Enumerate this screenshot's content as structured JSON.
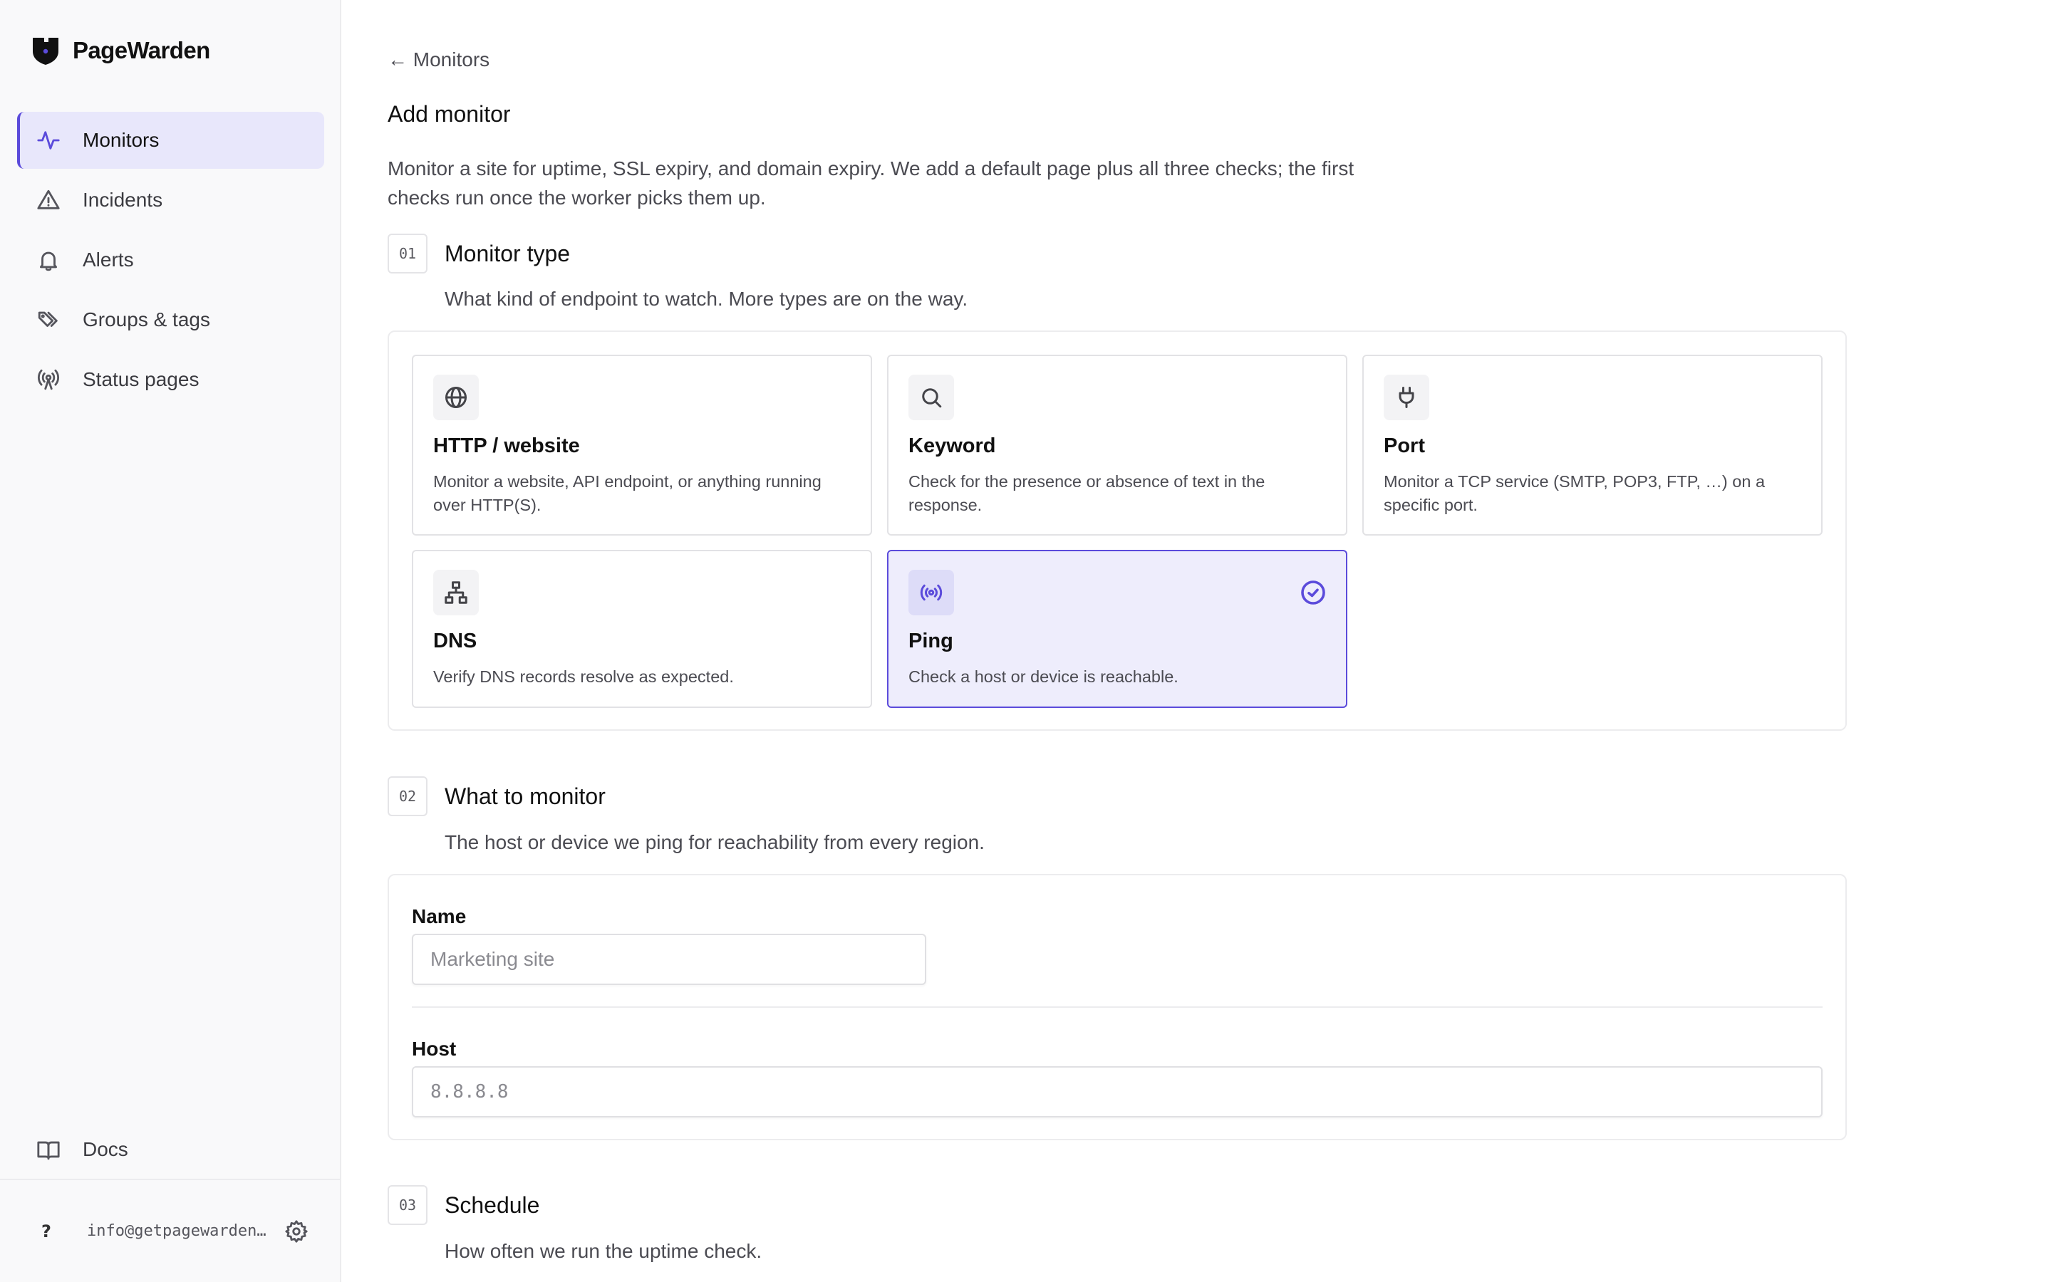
{
  "sidebar": {
    "brand": "PageWarden",
    "nav": [
      {
        "label": "Monitors",
        "icon": "activity-icon",
        "active": true
      },
      {
        "label": "Incidents",
        "icon": "warning-triangle-icon",
        "active": false
      },
      {
        "label": "Alerts",
        "icon": "bell-icon",
        "active": false
      },
      {
        "label": "Groups & tags",
        "icon": "tags-icon",
        "active": false
      },
      {
        "label": "Status pages",
        "icon": "broadcast-icon",
        "active": false
      }
    ],
    "docs": {
      "label": "Docs",
      "icon": "book-icon"
    },
    "footer": {
      "help": "?",
      "email": "info@getpagewarden…",
      "settings_icon": "gear-icon"
    }
  },
  "main": {
    "back_link": "← Monitors",
    "title": "Add monitor",
    "intro": "Monitor a site for uptime, SSL expiry, and domain expiry. We add a default page plus all three checks; the first checks run once the worker picks them up.",
    "sections": [
      {
        "num": "01",
        "title": "Monitor type",
        "desc": "What kind of endpoint to watch. More types are on the way."
      },
      {
        "num": "02",
        "title": "What to monitor",
        "desc": "The host or device we ping for reachability from every region."
      },
      {
        "num": "03",
        "title": "Schedule",
        "desc": "How often we run the uptime check."
      }
    ],
    "types": [
      {
        "name": "HTTP / website",
        "desc": "Monitor a website, API endpoint, or anything running over HTTP(S).",
        "icon": "globe-icon",
        "selected": false
      },
      {
        "name": "Keyword",
        "desc": "Check for the presence or absence of text in the response.",
        "icon": "search-icon",
        "selected": false
      },
      {
        "name": "Port",
        "desc": "Monitor a TCP service (SMTP, POP3, FTP, …) on a specific port.",
        "icon": "plug-icon",
        "selected": false
      },
      {
        "name": "DNS",
        "desc": "Verify DNS records resolve as expected.",
        "icon": "network-icon",
        "selected": false
      },
      {
        "name": "Ping",
        "desc": "Check a host or device is reachable.",
        "icon": "broadcast-icon",
        "selected": true
      }
    ],
    "form": {
      "name_label": "Name",
      "name_value": "",
      "name_placeholder": "Marketing site",
      "host_label": "Host",
      "host_value": "",
      "host_placeholder": "8.8.8.8"
    }
  },
  "colors": {
    "accent": "#5b4bdb",
    "active_bg": "#e8e7fb",
    "selected_bg": "#eeedfc"
  }
}
